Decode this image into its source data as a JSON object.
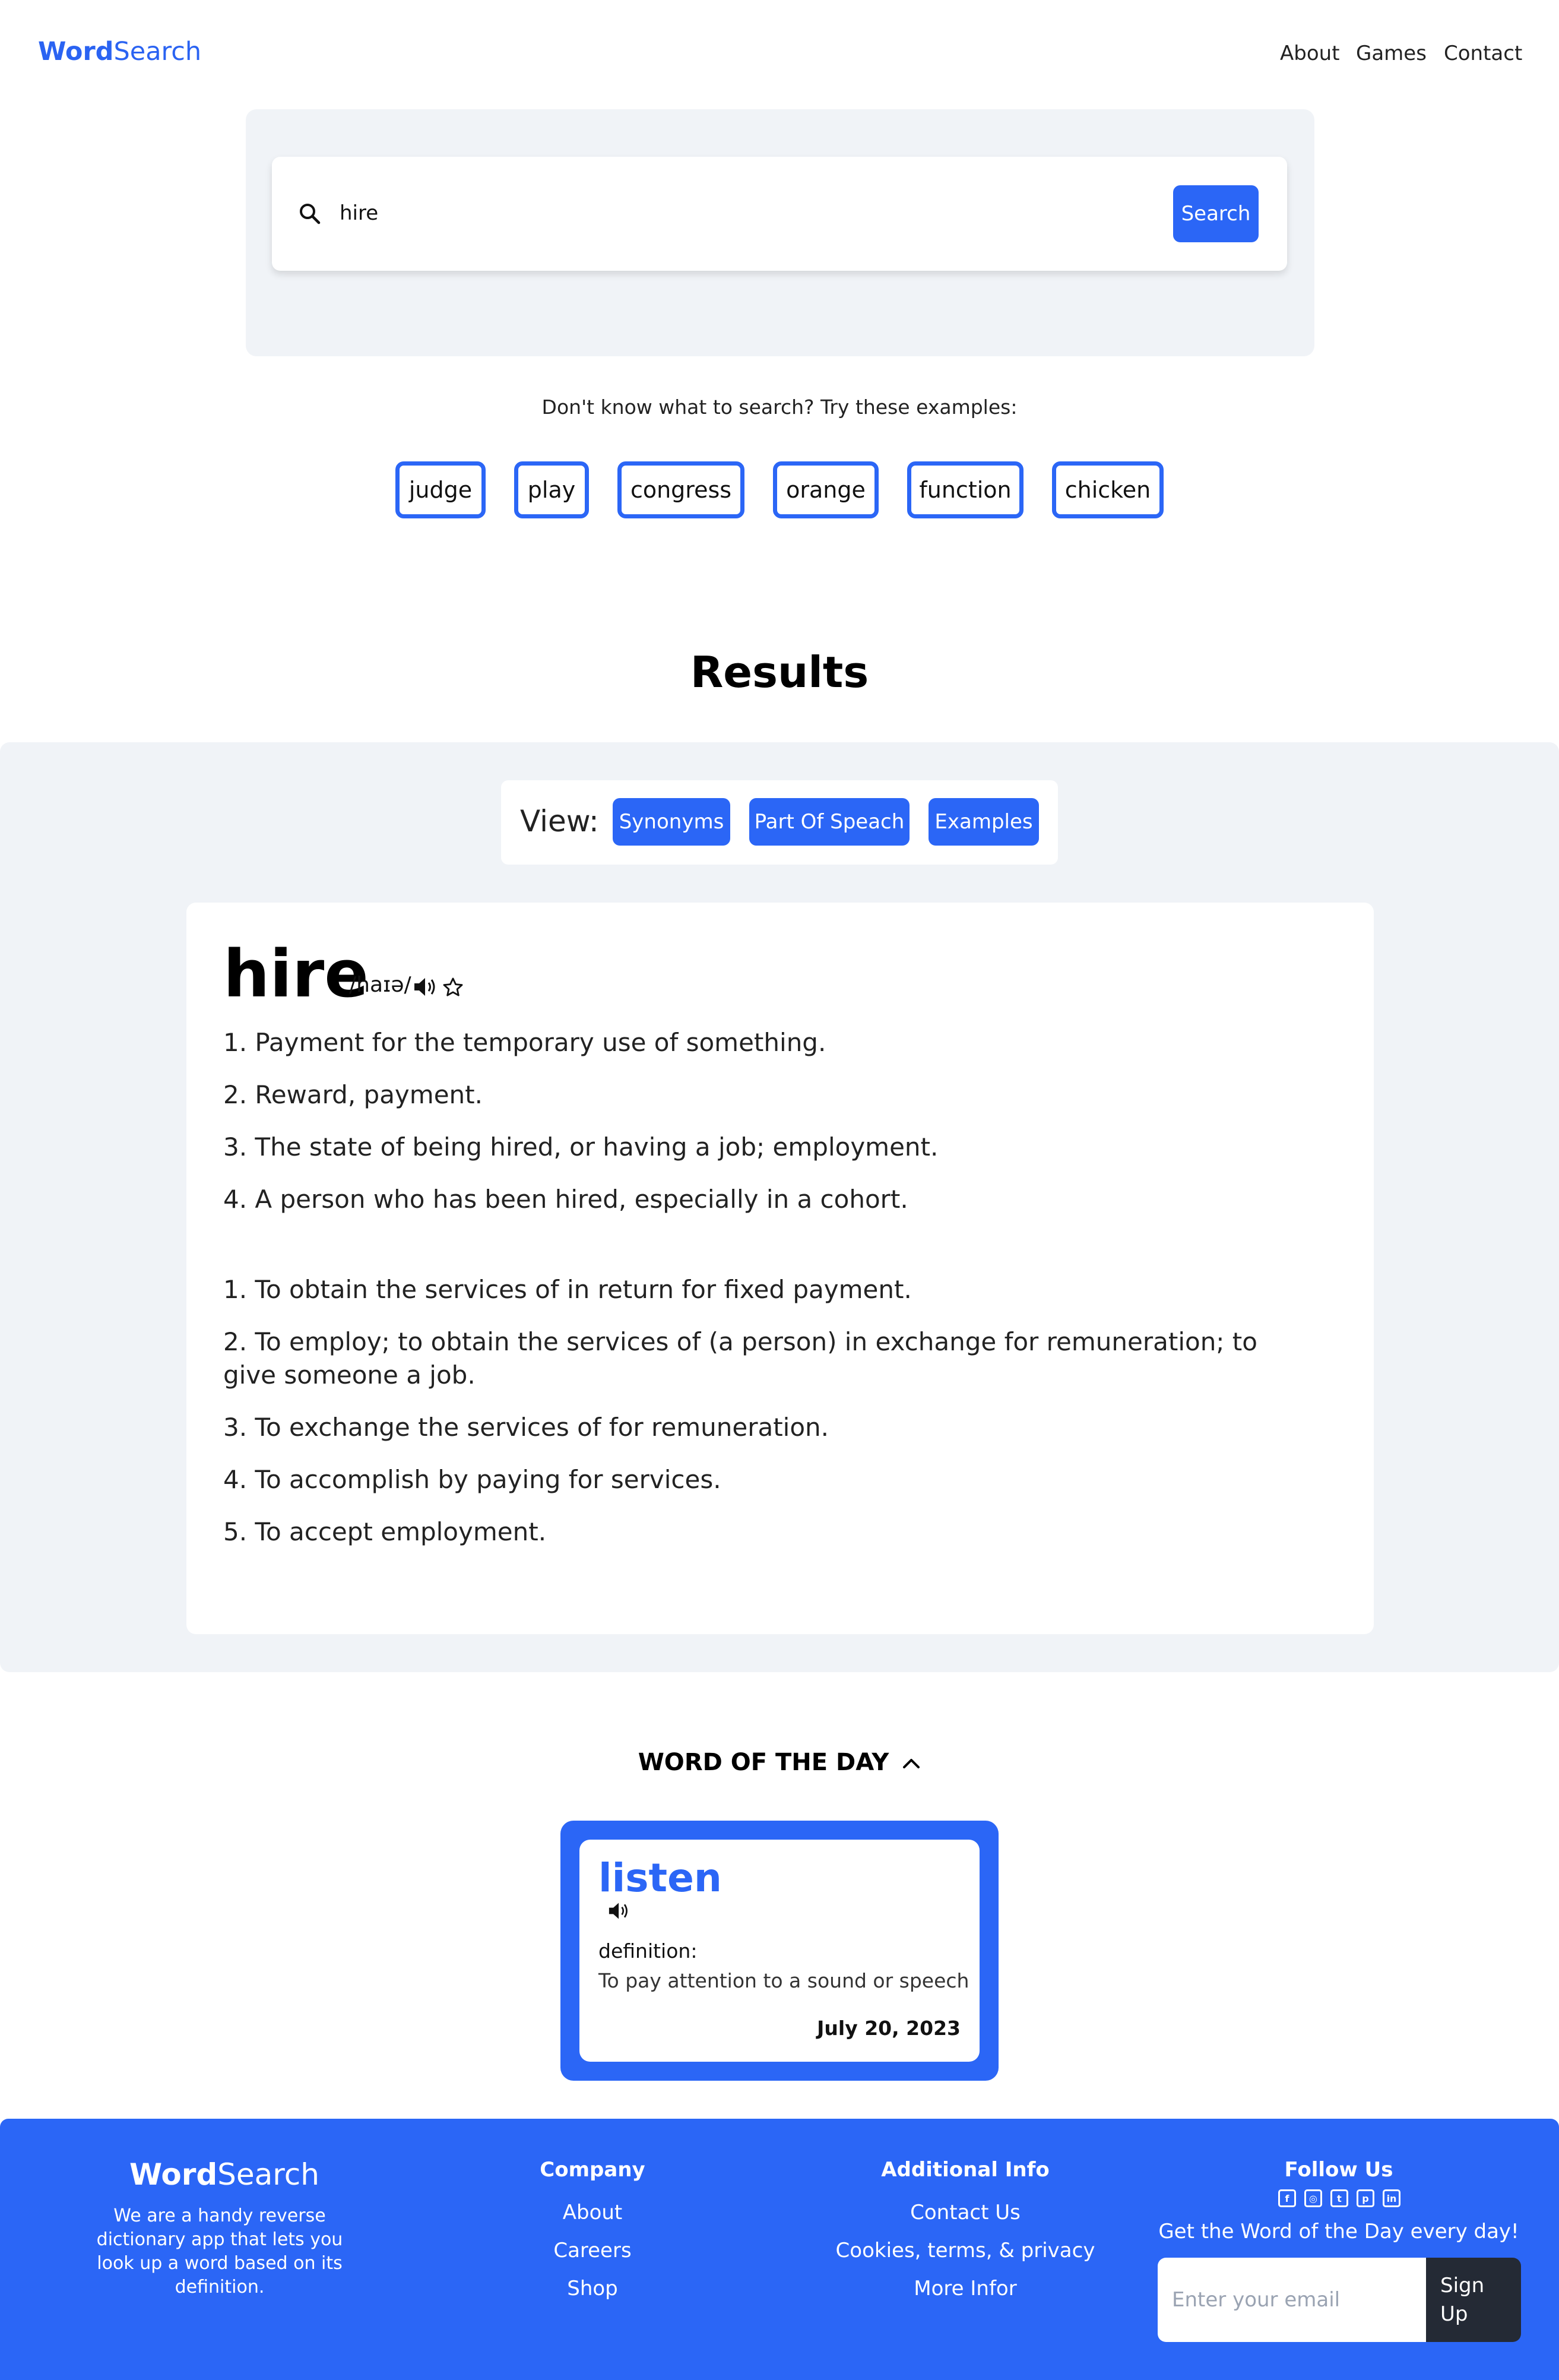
{
  "nav": {
    "brand_bold": "Word",
    "brand_rest": "Search",
    "links": [
      "About",
      "Games",
      "Contact"
    ]
  },
  "search": {
    "value": "hire",
    "button_label": "Search",
    "hint": "Don't know what to search? Try these examples:",
    "examples": [
      "judge",
      "play",
      "congress",
      "orange",
      "function",
      "chicken"
    ]
  },
  "results": {
    "title": "Results",
    "view_label": "View:",
    "view_buttons": [
      "Synonyms",
      "Part Of Speach",
      "Examples"
    ],
    "word": "hire",
    "phonetic": "/haɪə/",
    "noun_defs": [
      "1. Payment for the temporary use of something.",
      "2. Reward, payment.",
      "3. The state of being hired, or having a job; employment.",
      "4. A person who has been hired, especially in a cohort."
    ],
    "verb_defs": [
      "1. To obtain the services of in return for fixed payment.",
      "2. To employ; to obtain the services of (a person) in exchange for remuneration; to give someone a job.",
      "3. To exchange the services of for remuneration.",
      "4. To accomplish by paying for services.",
      "5. To accept employment."
    ]
  },
  "wotd": {
    "title": "WORD OF THE DAY",
    "word": "listen",
    "definition_label": "definition:",
    "definition": "To pay attention to a sound or speech",
    "date": "July 20, 2023"
  },
  "footer": {
    "brand_bold": "Word",
    "brand_rest": "Search",
    "about": "We are a handy reverse dictionary app that lets you look up a word based on its definition.",
    "company_heading": "Company",
    "company_links": [
      "About",
      "Careers",
      "Shop"
    ],
    "info_heading": "Additional Info",
    "info_links": [
      "Contact Us",
      "Cookies, terms, & privacy",
      "More Infor"
    ],
    "follow_heading": "Follow Us",
    "social_icons": [
      "facebook-icon",
      "instagram-icon",
      "twitter-icon",
      "pinterest-icon",
      "linkedin-icon"
    ],
    "tagline": "Get the Word of the Day every day!",
    "email_placeholder": "Enter your email",
    "signup_label": "Sign Up"
  },
  "colors": {
    "accent": "#2b66f6",
    "panel": "#f0f3f7",
    "dark_button": "#242a35"
  }
}
